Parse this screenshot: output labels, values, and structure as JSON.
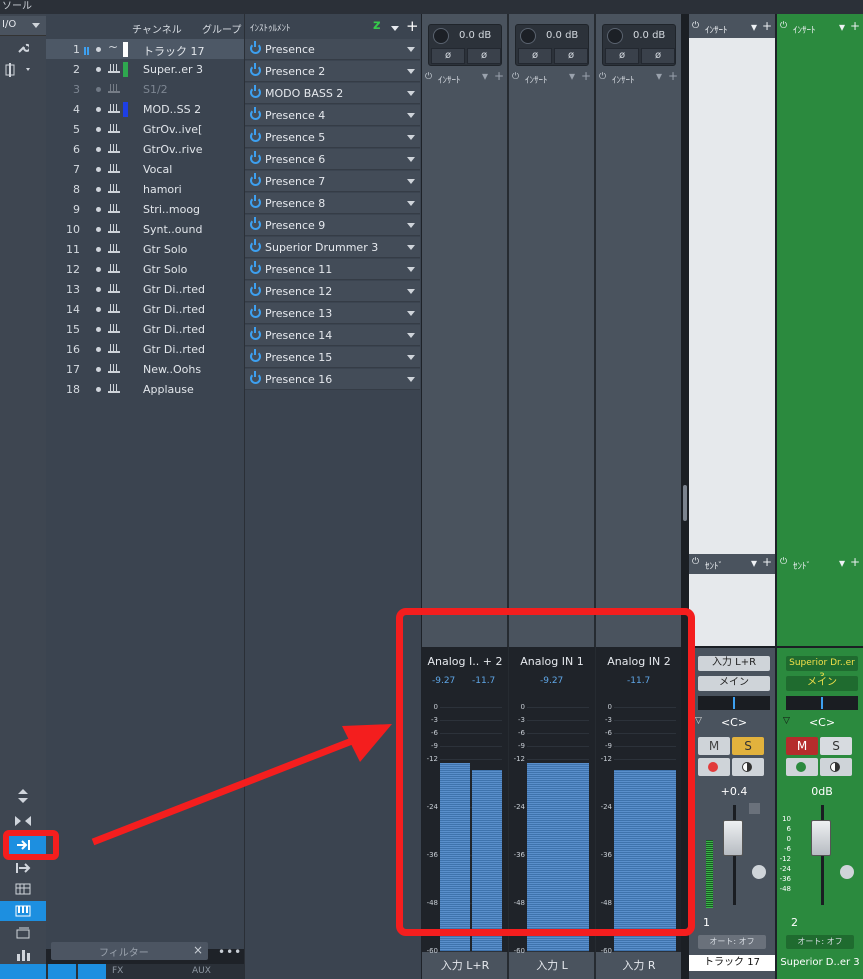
{
  "window": {
    "title": "ソール"
  },
  "left_strip": {
    "io_label": "I/O"
  },
  "channel_list": {
    "header_channel": "チャンネル",
    "header_group": "グループ",
    "rows": [
      {
        "num": "1",
        "name": "トラック 17",
        "color": "#ffffff",
        "type": "audio",
        "selected": true,
        "dim": false
      },
      {
        "num": "2",
        "name": "Super..er 3",
        "color": "#2fa84f",
        "type": "inst",
        "selected": false,
        "dim": false
      },
      {
        "num": "3",
        "name": "S1/2",
        "color": "",
        "type": "inst",
        "selected": false,
        "dim": true
      },
      {
        "num": "4",
        "name": "MOD..SS 2",
        "color": "#1e3fe6",
        "type": "inst",
        "selected": false,
        "dim": false
      },
      {
        "num": "5",
        "name": "GtrOv..ive[",
        "color": "",
        "type": "inst",
        "selected": false,
        "dim": false
      },
      {
        "num": "6",
        "name": "GtrOv..rive",
        "color": "",
        "type": "inst",
        "selected": false,
        "dim": false
      },
      {
        "num": "7",
        "name": "Vocal",
        "color": "",
        "type": "inst",
        "selected": false,
        "dim": false
      },
      {
        "num": "8",
        "name": "hamori",
        "color": "",
        "type": "inst",
        "selected": false,
        "dim": false
      },
      {
        "num": "9",
        "name": "Stri..moog",
        "color": "",
        "type": "inst",
        "selected": false,
        "dim": false
      },
      {
        "num": "10",
        "name": "Synt..ound",
        "color": "",
        "type": "inst",
        "selected": false,
        "dim": false
      },
      {
        "num": "11",
        "name": "Gtr Solo",
        "color": "",
        "type": "inst",
        "selected": false,
        "dim": false
      },
      {
        "num": "12",
        "name": "Gtr Solo",
        "color": "",
        "type": "inst",
        "selected": false,
        "dim": false
      },
      {
        "num": "13",
        "name": "Gtr Di..rted",
        "color": "",
        "type": "inst",
        "selected": false,
        "dim": false
      },
      {
        "num": "14",
        "name": "Gtr Di..rted",
        "color": "",
        "type": "inst",
        "selected": false,
        "dim": false
      },
      {
        "num": "15",
        "name": "Gtr Di..rted",
        "color": "",
        "type": "inst",
        "selected": false,
        "dim": false
      },
      {
        "num": "16",
        "name": "Gtr Di..rted",
        "color": "",
        "type": "inst",
        "selected": false,
        "dim": false
      },
      {
        "num": "17",
        "name": "New..Oohs",
        "color": "",
        "type": "inst",
        "selected": false,
        "dim": false
      },
      {
        "num": "18",
        "name": "Applause",
        "color": "",
        "type": "inst",
        "selected": false,
        "dim": false
      }
    ],
    "filter_placeholder": "フィルター"
  },
  "instruments": {
    "header": "ｲﾝｽﾄｩﾙﾒﾝﾄ",
    "items": [
      "Presence",
      "Presence 2",
      "MODO BASS 2",
      "Presence 4",
      "Presence 5",
      "Presence 6",
      "Presence 7",
      "Presence 8",
      "Presence 9",
      "Superior Drummer 3",
      "Presence 11",
      "Presence 12",
      "Presence 13",
      "Presence 14",
      "Presence 15",
      "Presence 16"
    ]
  },
  "input_strips": [
    {
      "gain": "0.0 dB",
      "insert": "ｲﾝｻｰﾄ",
      "label": "Analog I.. + 2",
      "peaks": [
        "-9.27",
        "-11.7"
      ],
      "levels": [
        0.77,
        0.74
      ],
      "input": "入力 L+R"
    },
    {
      "gain": "0.0 dB",
      "insert": "ｲﾝｻｰﾄ",
      "label": "Analog IN 1",
      "peaks": [
        "-9.27"
      ],
      "levels": [
        0.77
      ],
      "input": "入力 L"
    },
    {
      "gain": "0.0 dB",
      "insert": "ｲﾝｻｰﾄ",
      "label": "Analog IN 2",
      "peaks": [
        "-11.7"
      ],
      "levels": [
        0.74
      ],
      "input": "入力 R"
    }
  ],
  "meter_scale": [
    "0",
    "-3",
    "-6",
    "-9",
    "-12",
    "-24",
    "-36",
    "-48",
    "-60"
  ],
  "phase_symbol": "ø",
  "channel_strips": [
    {
      "insert": "ｲﾝｻｰﾄ",
      "send": "ｾﾝﾄﾞ",
      "input": "入力 L+R",
      "output": "メイン",
      "pan": "<C>",
      "mute": "M",
      "solo": "S",
      "volume": "+0.4",
      "number": "1",
      "auto": "オート: オフ",
      "name": "トラック 17"
    },
    {
      "insert": "ｲﾝｻｰﾄ",
      "send": "ｾﾝﾄﾞ",
      "input": "Superior Dr..er 3",
      "output": "メイン",
      "pan": "<C>",
      "mute": "M",
      "solo": "S",
      "volume": "0dB",
      "number": "2",
      "auto": "オート: オフ",
      "name": "Superior D..er 3"
    }
  ],
  "fader_scale": [
    "10",
    "6",
    "0",
    "-6",
    "-12",
    "-24",
    "-36",
    "-48"
  ],
  "bottom_tabs": [
    "FX",
    "AUX"
  ],
  "colors": {
    "accent": "#1d8fe0",
    "highlight_red": "#f41e1e",
    "strip_green": "#2b8a3e",
    "power_blue": "#3da0f0"
  }
}
